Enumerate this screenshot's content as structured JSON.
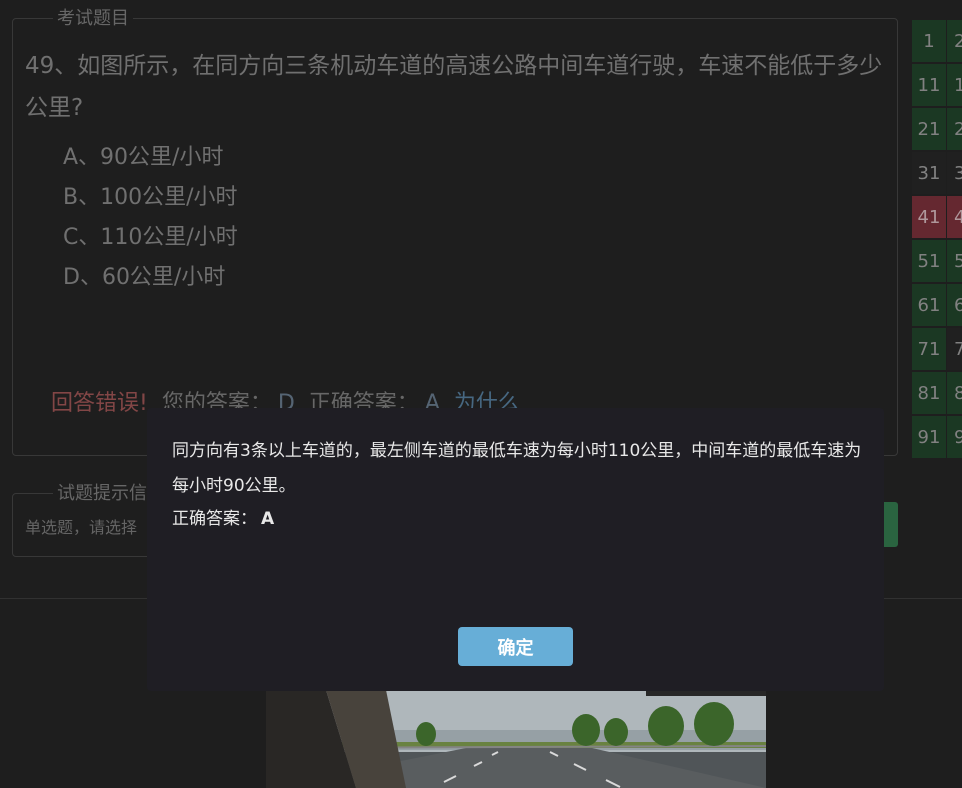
{
  "question_panel": {
    "legend": "考试题目",
    "question_text": "49、如图所示，在同方向三条机动车道的高速公路中间车道行驶，车速不能低于多少公里?",
    "options": [
      {
        "label": "A、90公里/小时"
      },
      {
        "label": "B、100公里/小时"
      },
      {
        "label": "C、110公里/小时"
      },
      {
        "label": "D、60公里/小时"
      }
    ],
    "result": {
      "status": "回答错误!",
      "your_answer_label": "您的答案：",
      "your_answer": "D",
      "correct_answer_label": "正确答案：",
      "correct_answer": "A",
      "why_link": "为什么"
    }
  },
  "hint_panel": {
    "legend": "试题提示信",
    "text": "单选题，请选择"
  },
  "number_grid": {
    "rows": [
      {
        "a": "1",
        "b": "2",
        "state": "correct"
      },
      {
        "a": "11",
        "b": "1",
        "state": "correct"
      },
      {
        "a": "21",
        "b": "2",
        "state": "correct"
      },
      {
        "a": "31",
        "b": "3",
        "state": "none"
      },
      {
        "a": "41",
        "b": "4",
        "state": "wrong"
      },
      {
        "a": "51",
        "b": "5",
        "state": "correct"
      },
      {
        "a": "61",
        "b": "6",
        "state": "correct"
      },
      {
        "a": "71",
        "b": "7",
        "state": "mixed"
      },
      {
        "a": "81",
        "b": "8",
        "state": "correct"
      },
      {
        "a": "91",
        "b": "9",
        "state": "correct"
      }
    ]
  },
  "modal": {
    "explanation": "同方向有3条以上车道的，最左侧车道的最低车速为每小时110公里，中间车道的最低车速为每小时90公里。",
    "answer_label": "正确答案：",
    "answer_value": "A",
    "ok_button": "确定"
  },
  "colors": {
    "correct_cell": "#1d3b25",
    "wrong_cell": "#6b2b33",
    "none_cell": "#222222",
    "ok_button": "#67aed7"
  }
}
